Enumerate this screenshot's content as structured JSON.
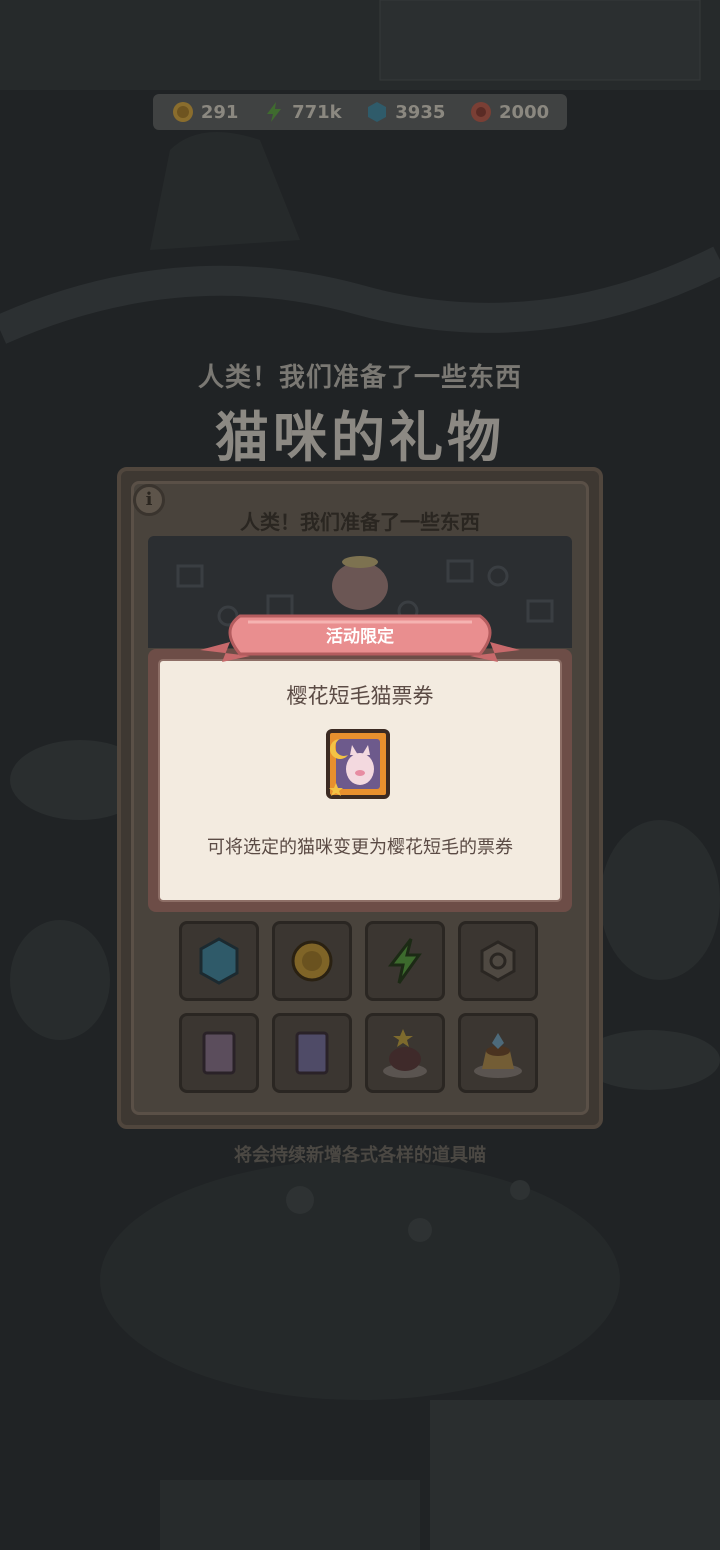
{
  "currencies": [
    {
      "icon": "gold-coin-icon",
      "value": "291"
    },
    {
      "icon": "lightning-energy-icon",
      "value": "771k"
    },
    {
      "icon": "blue-gem-icon",
      "value": "3935"
    },
    {
      "icon": "red-token-icon",
      "value": "2000"
    }
  ],
  "header": {
    "subtitle": "人类！我们准备了一些东西",
    "title": "猫咪的礼物"
  },
  "panel": {
    "title": "人类！我们准备了一些东西",
    "info_icon": "i",
    "footer": "将会持续新增各式各样的道具喵"
  },
  "popup": {
    "ribbon": "活动限定",
    "item_name": "樱花短毛猫票券",
    "item_icon": "sakura-cat-ticket-icon",
    "description": "可将选定的猫咪变更为樱花短毛的票券"
  },
  "grid_items": [
    "blue-gem-icon",
    "gold-coin-icon",
    "lightning-energy-icon",
    "gear-token-icon",
    "moon-ticket-icon",
    "moon-ticket-icon",
    "star-cake-icon",
    "fish-pudding-icon"
  ],
  "colors": {
    "background": "#1f2224",
    "popup_frame": "#6d4d47",
    "popup_body": "#f3ebe0",
    "ribbon": "#e98e8f",
    "text": "#5b4b45"
  }
}
